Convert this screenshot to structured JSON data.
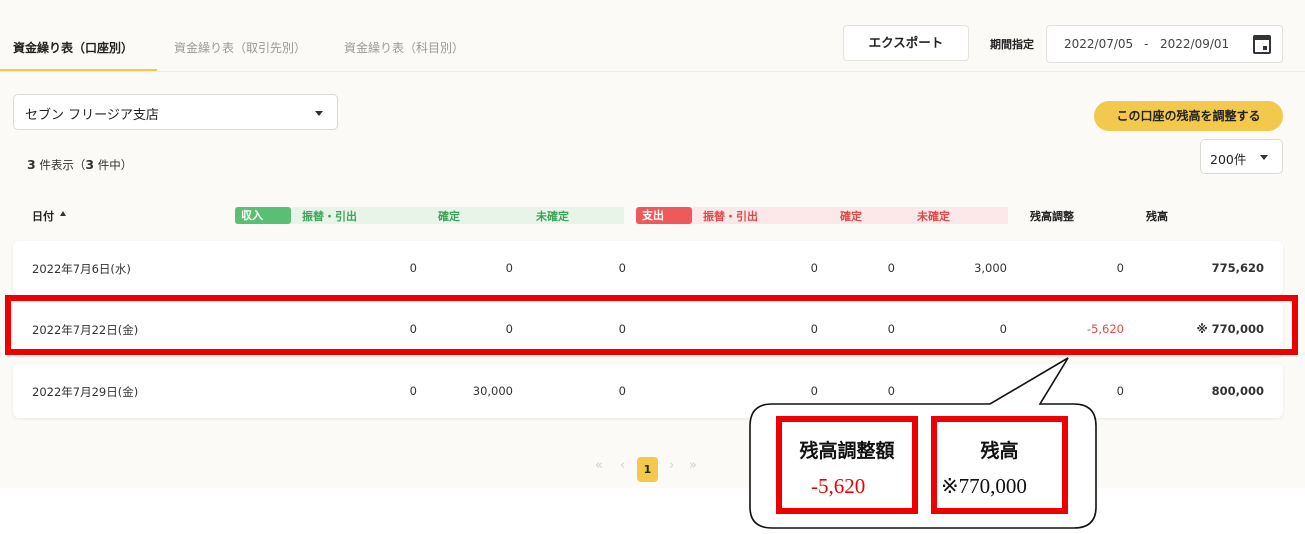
{
  "tabs": [
    {
      "label": "資金繰り表（口座別）",
      "active": true
    },
    {
      "label": "資金繰り表（取引先別）",
      "active": false
    },
    {
      "label": "資金繰り表（科目別）",
      "active": false
    }
  ],
  "toolbar": {
    "export_label": "エクスポート",
    "period_label": "期間指定",
    "date_from": "2022/07/05",
    "date_sep": "-",
    "date_to": "2022/09/01",
    "calendar_icon": "calendar-icon"
  },
  "account_select": {
    "value": "セブン フリージア支店"
  },
  "adjust_button": "この口座の残高を調整する",
  "count": {
    "shown": "3",
    "shown_suffix": "件表示（",
    "total": "3",
    "total_suffix": "件中）"
  },
  "page_size": {
    "value": "200件"
  },
  "header": {
    "date": "日付",
    "income_badge": "収入",
    "income_transfer": "振替・引出",
    "income_confirmed": "確定",
    "income_unconfirmed": "未確定",
    "expense_badge": "支出",
    "expense_transfer": "振替・引出",
    "expense_confirmed": "確定",
    "expense_unconfirmed": "未確定",
    "adjustment": "残高調整",
    "balance": "残高"
  },
  "rows": [
    {
      "date": "2022年7月6日(水)",
      "in_transfer": "0",
      "in_confirmed": "0",
      "in_unconfirmed": "0",
      "out_transfer": "0",
      "out_confirmed": "0",
      "out_unconfirmed": "3,000",
      "adjustment": "0",
      "balance": "775,620"
    },
    {
      "date": "2022年7月22日(金)",
      "in_transfer": "0",
      "in_confirmed": "0",
      "in_unconfirmed": "0",
      "out_transfer": "0",
      "out_confirmed": "0",
      "out_unconfirmed": "0",
      "adjustment": "-5,620",
      "balance": "※ 770,000"
    },
    {
      "date": "2022年7月29日(金)",
      "in_transfer": "0",
      "in_confirmed": "30,000",
      "in_unconfirmed": "0",
      "out_transfer": "0",
      "out_confirmed": "0",
      "out_unconfirmed": "",
      "adjustment": "0",
      "balance": "800,000"
    }
  ],
  "pagination": {
    "first": "«",
    "prev": "‹",
    "current": "1",
    "next": "›",
    "last": "»"
  },
  "callout": {
    "adjustment_title": "残高調整額",
    "adjustment_value": "-5,620",
    "balance_title": "残高",
    "balance_value": "※770,000"
  },
  "colors": {
    "accent": "#f2c94c",
    "income": "#5bbf73",
    "expense": "#ee5a5a",
    "highlight": "#ee0000"
  }
}
